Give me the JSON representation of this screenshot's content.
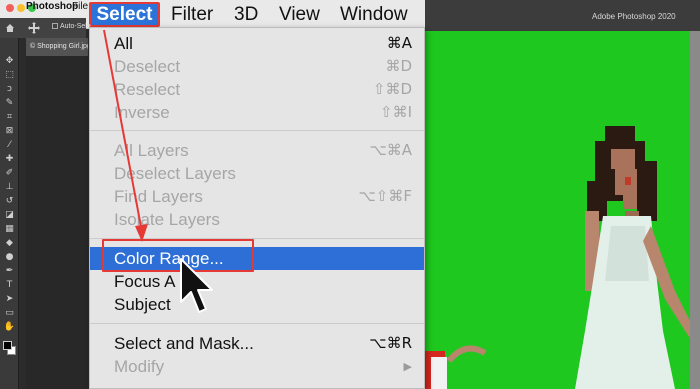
{
  "menubar": {
    "app_name": "Photoshop",
    "file_label": "File",
    "items": [
      {
        "label": "Select"
      },
      {
        "label": "Filter"
      },
      {
        "label": "3D"
      },
      {
        "label": "View"
      },
      {
        "label": "Window"
      }
    ]
  },
  "optionsbar": {
    "auto_select_label": "Auto-Sele"
  },
  "document": {
    "tab_label": "© Shopping Girl.jpg"
  },
  "titlebar": {
    "app_title": "Adobe Photoshop 2020"
  },
  "select_menu": {
    "items": [
      {
        "label": "All",
        "shortcut": "⌘A",
        "enabled": true
      },
      {
        "label": "Deselect",
        "shortcut": "⌘D",
        "enabled": false
      },
      {
        "label": "Reselect",
        "shortcut": "⇧⌘D",
        "enabled": false
      },
      {
        "label": "Inverse",
        "shortcut": "⇧⌘I",
        "enabled": false
      },
      {
        "label": "All Layers",
        "shortcut": "⌥⌘A",
        "enabled": false
      },
      {
        "label": "Deselect Layers",
        "shortcut": "",
        "enabled": false
      },
      {
        "label": "Find Layers",
        "shortcut": "⌥⇧⌘F",
        "enabled": false
      },
      {
        "label": "Isolate Layers",
        "shortcut": "",
        "enabled": false
      },
      {
        "label": "Color Range...",
        "shortcut": "",
        "enabled": true,
        "highlighted": true
      },
      {
        "label": "Focus A",
        "shortcut": "",
        "enabled": true
      },
      {
        "label": "Subject",
        "shortcut": "",
        "enabled": true
      },
      {
        "label": "Select and Mask...",
        "shortcut": "⌥⌘R",
        "enabled": true
      },
      {
        "label": "Modify",
        "shortcut": "▶",
        "enabled": false
      }
    ]
  },
  "colors": {
    "highlight": "#2d6fd6",
    "annotation_red": "#e53935",
    "green_screen": "#1ec81e"
  }
}
